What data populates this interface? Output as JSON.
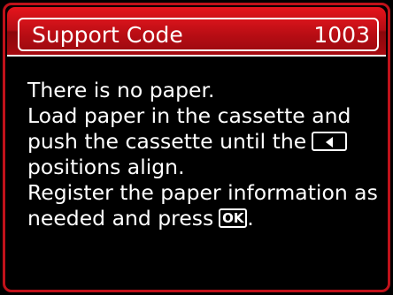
{
  "header": {
    "title": "Support Code",
    "code": "1003"
  },
  "message": {
    "line1": "There is no paper.",
    "line2": "Load paper in the cassette and",
    "line3a": "push the cassette until the",
    "line3_icon": "left-triangle-icon",
    "line4": "positions align.",
    "line5": "Register the paper information as",
    "line6a": "needed and press",
    "ok_label": "OK",
    "line6b": "."
  },
  "colors": {
    "header_red": "#c0121a",
    "text": "#ffffff",
    "background": "#000000"
  }
}
